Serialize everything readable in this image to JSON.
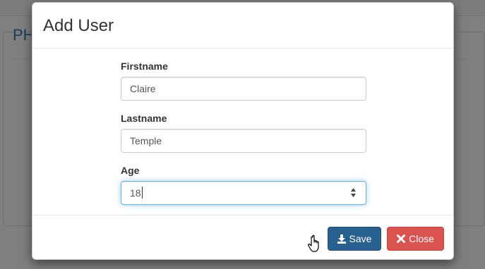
{
  "background": {
    "panel_title": "PH"
  },
  "modal": {
    "title": "Add User",
    "fields": {
      "firstname": {
        "label": "Firstname",
        "value": "Claire"
      },
      "lastname": {
        "label": "Lastname",
        "value": "Temple"
      },
      "age": {
        "label": "Age",
        "value": "18"
      }
    },
    "footer": {
      "save_label": "Save",
      "save_icon": "download-icon",
      "close_label": "Close",
      "close_icon": "close-x-icon"
    }
  },
  "colors": {
    "primary": "#286090",
    "danger": "#d9534f",
    "focus": "#66afe9",
    "link": "#337ab7"
  }
}
